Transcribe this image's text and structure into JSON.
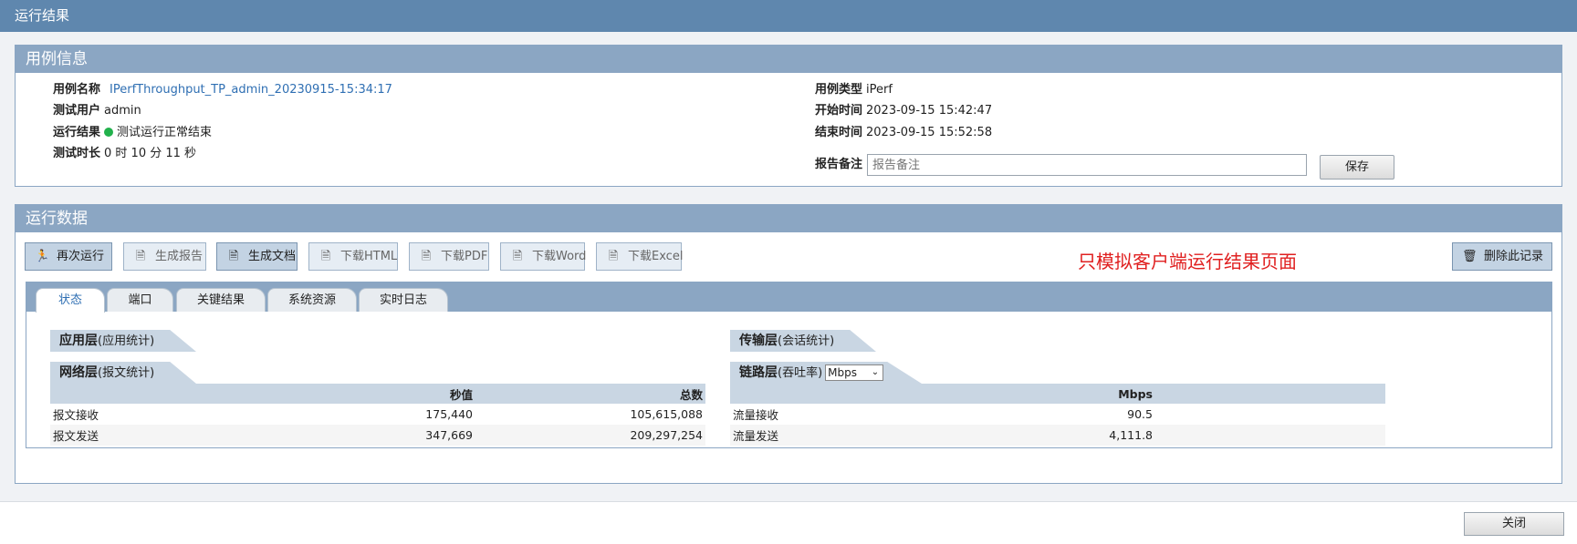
{
  "window": {
    "title": "运行结果"
  },
  "case_info": {
    "title": "用例信息",
    "name_label": "用例名称",
    "name_value": "IPerfThroughput_TP_admin_20230915-15:34:17",
    "user_label": "测试用户",
    "user_value": "admin",
    "result_label": "运行结果",
    "result_value": "测试运行正常结束",
    "result_color": "#22b14c",
    "duration_label": "测试时长",
    "duration_value": "0 时 10 分 11 秒",
    "type_label": "用例类型",
    "type_value": "iPerf",
    "start_label": "开始时间",
    "start_value": "2023-09-15 15:42:47",
    "end_label": "结束时间",
    "end_value": "2023-09-15 15:52:58",
    "note_label": "报告备注",
    "note_placeholder": "报告备注",
    "save_label": "保存"
  },
  "run_data": {
    "title": "运行数据",
    "toolbar": {
      "rerun": "再次运行",
      "gen_report": "生成报告",
      "gen_doc": "生成文档",
      "dl_html": "下载HTML",
      "dl_pdf": "下载PDF",
      "dl_word": "下载Word",
      "dl_excel": "下载Excel",
      "delete": "删除此记录"
    },
    "notice": "只模拟客户端运行结果页面",
    "tabs": [
      "状态",
      "端口",
      "关键结果",
      "系统资源",
      "实时日志"
    ],
    "app_layer": {
      "title": "应用层",
      "sub": "(应用统计)"
    },
    "transport_layer": {
      "title": "传输层",
      "sub": "(会话统计)"
    },
    "network_layer": {
      "title": "网络层",
      "sub": "(报文统计)",
      "columns": [
        "秒值",
        "总数"
      ],
      "rows": [
        {
          "label": "报文接收",
          "per_sec": "175,440",
          "total": "105,615,088"
        },
        {
          "label": "报文发送",
          "per_sec": "347,669",
          "total": "209,297,254"
        }
      ]
    },
    "link_layer": {
      "title": "链路层",
      "sub": "(吞吐率)",
      "unit_select": "Mbps",
      "columns": [
        "Mbps"
      ],
      "rows": [
        {
          "label": "流量接收",
          "value": "90.5"
        },
        {
          "label": "流量发送",
          "value": "4,111.8"
        }
      ]
    }
  },
  "footer": {
    "close_label": "关闭"
  }
}
